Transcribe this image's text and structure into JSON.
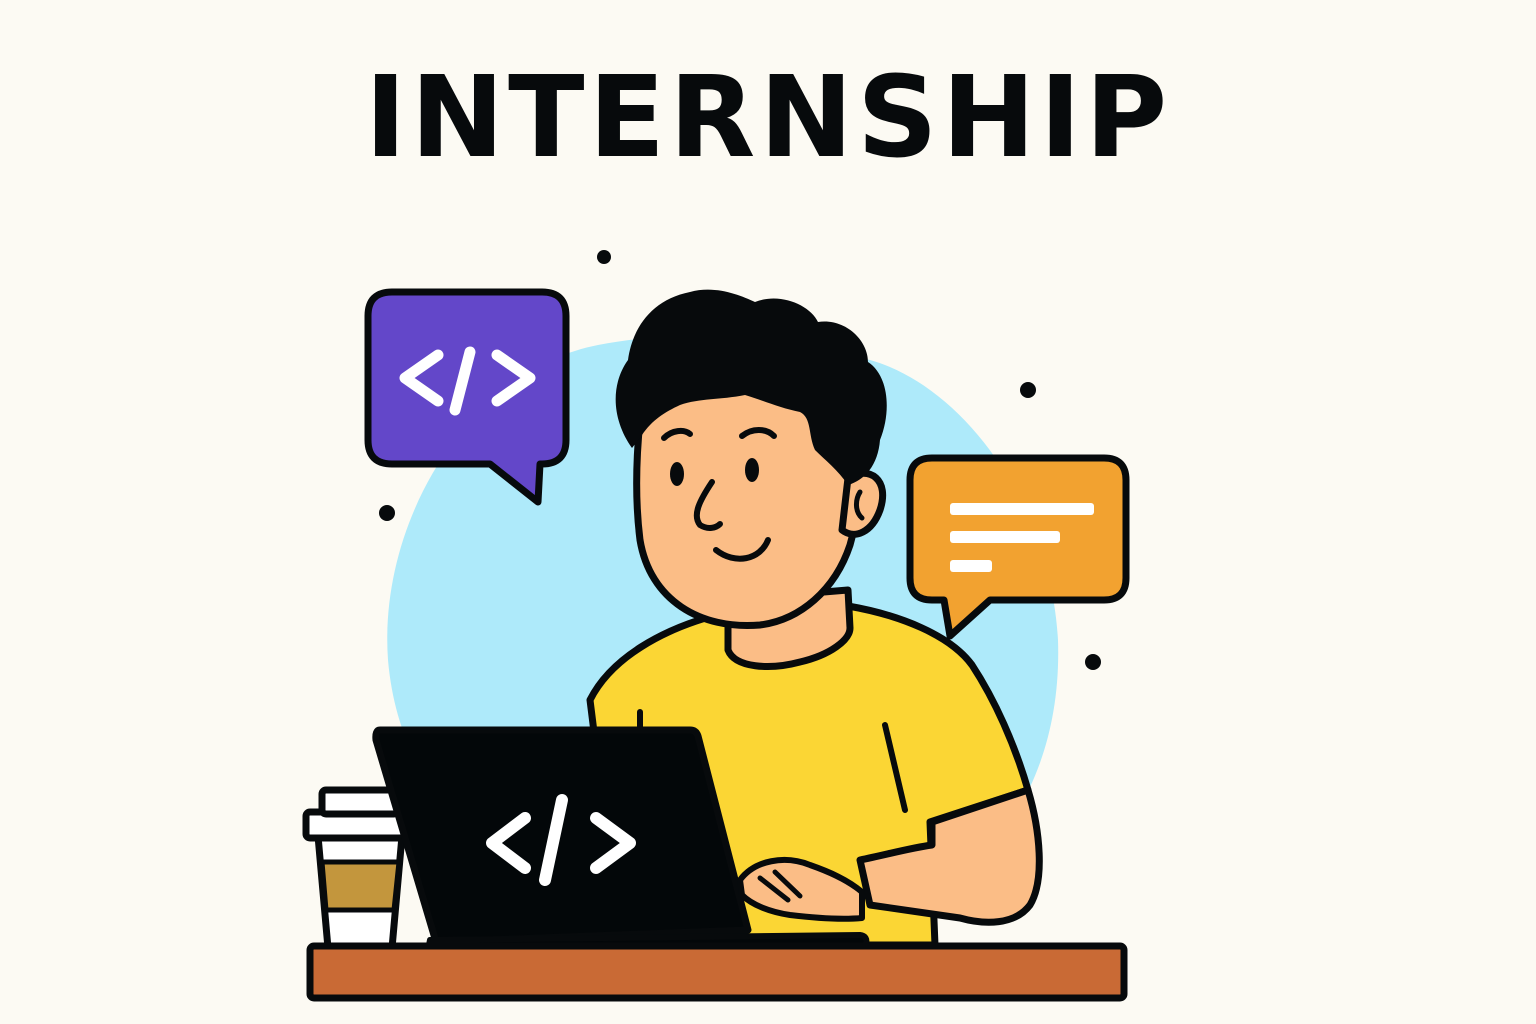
{
  "header": {
    "title": "INTERNSHIP"
  },
  "illustration": {
    "left_bubble_icon": "code-icon",
    "laptop_icon": "code-icon",
    "right_bubble_icon": "text-lines-icon",
    "colors": {
      "background": "#fcfaf3",
      "blob": "#aeeafa",
      "purple_bubble": "#6347c9",
      "orange_bubble": "#f2a230",
      "shirt": "#fbd634",
      "skin": "#fbbd86",
      "hair": "#070a0c",
      "laptop": "#030709",
      "desk": "#c96a35",
      "cup_sleeve": "#c3963d",
      "outline": "#070a0c"
    }
  }
}
